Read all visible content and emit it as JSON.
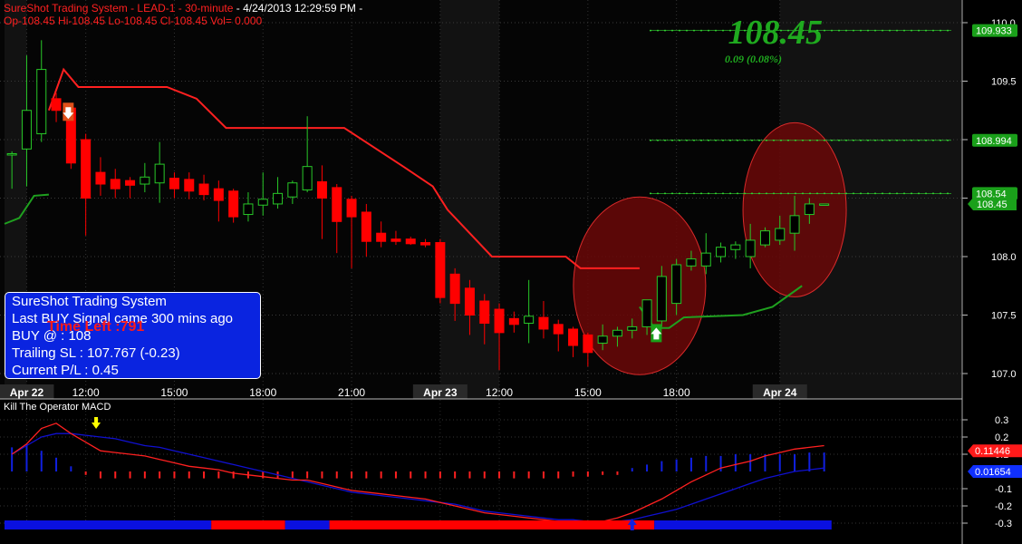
{
  "header": {
    "title": "SureShot Trading System - LEAD-1 - 30-minute",
    "datetime": "- 4/24/2013 12:29:59 PM -",
    "ohlc": "Op-108.45  Hi-108.45  Lo-108.45  Cl-108.45  Vol=   0.000"
  },
  "price_display": {
    "last": "108.45",
    "change": "0.09  (0.08%)"
  },
  "info_box": {
    "title": "SureShot Trading System",
    "signal": "Last BUY Signal came 300 mins ago",
    "entry": "BUY @   : 108",
    "trailing": "Trailing SL : 107.767 (-0.23)",
    "pl": "Current P/L : 0.45",
    "time_left": "Time Left :791"
  },
  "macd_title": "Kill The Operator MACD",
  "colors": {
    "up": "#28c828",
    "down": "#ff0000",
    "stop_up": "#1fa01f",
    "stop_down": "#ff2020",
    "macd_signal": "#1010d0",
    "macd_line": "#ff2020",
    "target": "#30d030",
    "ellipse": "#6a0808"
  },
  "chart_data": [
    {
      "type": "candlestick",
      "yticks": [
        "110.0",
        "109.5",
        "109",
        "108.5",
        "108.0",
        "107.5",
        "107.0"
      ],
      "ylim": [
        106.9,
        110.05
      ],
      "xticks": [
        "Apr 22",
        "12:00",
        "15:00",
        "18:00",
        "21:00",
        "Apr 23",
        "12:00",
        "15:00",
        "18:00",
        "Apr 24"
      ],
      "x_bold": [
        true,
        false,
        false,
        false,
        false,
        true,
        false,
        false,
        false,
        true
      ],
      "x_index": [
        1.5,
        5.5,
        11.5,
        17.5,
        23.5,
        29.5,
        33.5,
        39.5,
        45.5,
        52.5
      ],
      "candles": [
        [
          108.88,
          108.9,
          108.58,
          108.88
        ],
        [
          108.92,
          109.72,
          108.6,
          109.25
        ],
        [
          109.05,
          109.85,
          108.98,
          109.6
        ],
        [
          109.35,
          109.4,
          109.15,
          109.25
        ],
        [
          109.27,
          109.3,
          108.75,
          108.8
        ],
        [
          109.0,
          109.05,
          108.18,
          108.5
        ],
        [
          108.72,
          108.85,
          108.52,
          108.62
        ],
        [
          108.66,
          108.75,
          108.5,
          108.58
        ],
        [
          108.65,
          108.68,
          108.5,
          108.61
        ],
        [
          108.62,
          108.8,
          108.55,
          108.68
        ],
        [
          108.63,
          108.98,
          108.46,
          108.79
        ],
        [
          108.67,
          108.72,
          108.5,
          108.58
        ],
        [
          108.66,
          108.72,
          108.49,
          108.56
        ],
        [
          108.62,
          108.7,
          108.48,
          108.53
        ],
        [
          108.58,
          108.65,
          108.3,
          108.48
        ],
        [
          108.56,
          108.58,
          108.29,
          108.34
        ],
        [
          108.36,
          108.55,
          108.3,
          108.45
        ],
        [
          108.44,
          108.72,
          108.35,
          108.49
        ],
        [
          108.45,
          108.68,
          108.41,
          108.54
        ],
        [
          108.51,
          108.65,
          108.45,
          108.63
        ],
        [
          108.57,
          109.2,
          108.55,
          108.77
        ],
        [
          108.64,
          108.78,
          108.15,
          108.5
        ],
        [
          108.59,
          108.62,
          108.03,
          108.3
        ],
        [
          108.49,
          108.52,
          107.9,
          108.34
        ],
        [
          108.38,
          108.45,
          108.0,
          108.13
        ],
        [
          108.2,
          108.3,
          108.08,
          108.13
        ],
        [
          108.15,
          108.22,
          108.1,
          108.13
        ],
        [
          108.15,
          108.17,
          108.1,
          108.11
        ],
        [
          108.12,
          108.15,
          108.08,
          108.1
        ],
        [
          108.12,
          108.15,
          107.6,
          107.65
        ],
        [
          107.85,
          107.9,
          107.45,
          107.6
        ],
        [
          107.73,
          107.8,
          107.33,
          107.5
        ],
        [
          107.62,
          107.68,
          107.25,
          107.43
        ],
        [
          107.55,
          107.6,
          107.03,
          107.35
        ],
        [
          107.47,
          107.53,
          107.35,
          107.42
        ],
        [
          107.43,
          107.8,
          107.26,
          107.49
        ],
        [
          107.48,
          107.62,
          107.3,
          107.38
        ],
        [
          107.42,
          107.46,
          107.19,
          107.34
        ],
        [
          107.38,
          107.4,
          107.14,
          107.24
        ],
        [
          107.33,
          107.35,
          107.06,
          107.18
        ],
        [
          107.26,
          107.42,
          107.2,
          107.32
        ],
        [
          107.32,
          107.4,
          107.23,
          107.37
        ],
        [
          107.37,
          107.47,
          107.3,
          107.4
        ],
        [
          107.4,
          107.6,
          107.33,
          107.63
        ],
        [
          107.45,
          107.92,
          107.4,
          107.83
        ],
        [
          107.6,
          107.98,
          107.5,
          107.93
        ],
        [
          107.92,
          108.05,
          107.88,
          107.98
        ],
        [
          107.92,
          108.2,
          107.85,
          108.03
        ],
        [
          108.0,
          108.12,
          107.95,
          108.08
        ],
        [
          108.06,
          108.13,
          107.98,
          108.1
        ],
        [
          108.0,
          108.28,
          107.9,
          108.14
        ],
        [
          108.1,
          108.25,
          108.08,
          108.22
        ],
        [
          108.14,
          108.35,
          108.1,
          108.24
        ],
        [
          108.2,
          108.52,
          108.05,
          108.35
        ],
        [
          108.36,
          108.5,
          108.28,
          108.45
        ],
        [
          108.45,
          108.45,
          108.45,
          108.45
        ]
      ],
      "stop_line_up_1": [
        [
          0,
          108.28
        ],
        [
          1,
          108.33
        ],
        [
          2,
          108.52
        ],
        [
          3,
          108.53
        ]
      ],
      "stop_line_down": [
        [
          3,
          109.25
        ],
        [
          4,
          109.6
        ],
        [
          5,
          109.45
        ],
        [
          11,
          109.45
        ],
        [
          13,
          109.35
        ],
        [
          15,
          109.1
        ],
        [
          23,
          109.1
        ],
        [
          27,
          108.77
        ],
        [
          29,
          108.6
        ],
        [
          30,
          108.4
        ],
        [
          33,
          108.0
        ],
        [
          38,
          108.0
        ],
        [
          39,
          107.9
        ],
        [
          43,
          107.9
        ]
      ],
      "stop_line_up_2": [
        [
          43,
          107.57
        ],
        [
          44,
          107.39
        ],
        [
          45,
          107.39
        ],
        [
          46,
          107.48
        ],
        [
          50,
          107.5
        ],
        [
          52,
          107.57
        ],
        [
          54,
          107.75
        ]
      ],
      "target_levels": [
        {
          "value": 109.933,
          "label": "109.933"
        },
        {
          "value": 108.994,
          "label": "108.994"
        },
        {
          "value": 108.54,
          "label": "108.54"
        }
      ],
      "price_tag": "108.45",
      "sell_signal_index": 4,
      "buy_signal_index": 44
    },
    {
      "type": "macd",
      "yticks": [
        "0.3",
        "0.2",
        "0.1",
        "-0.1",
        "-0.2",
        "-0.3"
      ],
      "ylim": [
        -0.31,
        0.31
      ],
      "macd_line": [
        0.1,
        0.16,
        0.25,
        0.28,
        0.22,
        0.17,
        0.12,
        0.11,
        0.1,
        0.09,
        0.07,
        0.05,
        0.03,
        0.02,
        0.01,
        -0.01,
        -0.02,
        -0.03,
        -0.04,
        -0.05,
        -0.05,
        -0.07,
        -0.09,
        -0.11,
        -0.12,
        -0.13,
        -0.14,
        -0.15,
        -0.16,
        -0.18,
        -0.2,
        -0.22,
        -0.24,
        -0.25,
        -0.26,
        -0.27,
        -0.28,
        -0.29,
        -0.3,
        -0.31,
        -0.29,
        -0.27,
        -0.24,
        -0.2,
        -0.16,
        -0.11,
        -0.06,
        -0.02,
        0.02,
        0.04,
        0.06,
        0.09,
        0.11,
        0.13,
        0.14,
        0.15
      ],
      "signal_line": [
        0.1,
        0.15,
        0.2,
        0.22,
        0.22,
        0.21,
        0.2,
        0.19,
        0.17,
        0.15,
        0.14,
        0.12,
        0.1,
        0.08,
        0.06,
        0.04,
        0.02,
        0.0,
        -0.02,
        -0.04,
        -0.06,
        -0.08,
        -0.1,
        -0.12,
        -0.13,
        -0.14,
        -0.15,
        -0.16,
        -0.17,
        -0.18,
        -0.19,
        -0.21,
        -0.23,
        -0.24,
        -0.25,
        -0.26,
        -0.27,
        -0.28,
        -0.28,
        -0.29,
        -0.29,
        -0.29,
        -0.28,
        -0.26,
        -0.24,
        -0.22,
        -0.19,
        -0.16,
        -0.13,
        -0.1,
        -0.07,
        -0.04,
        -0.02,
        0.0,
        0.01,
        0.02
      ],
      "histogram": [
        0.14,
        0.16,
        0.12,
        0.08,
        0.03,
        -0.02,
        -0.04,
        -0.04,
        -0.04,
        -0.04,
        -0.04,
        -0.04,
        -0.04,
        -0.04,
        -0.04,
        -0.04,
        -0.04,
        -0.04,
        -0.04,
        -0.04,
        -0.04,
        -0.04,
        -0.04,
        -0.04,
        -0.04,
        -0.04,
        -0.04,
        -0.04,
        -0.04,
        -0.04,
        -0.04,
        -0.04,
        -0.04,
        -0.04,
        -0.04,
        -0.04,
        -0.04,
        -0.04,
        -0.03,
        -0.03,
        -0.02,
        -0.02,
        0.02,
        0.04,
        0.06,
        0.07,
        0.08,
        0.09,
        0.09,
        0.1,
        0.1,
        0.1,
        0.1,
        0.1,
        0.11,
        0.11
      ],
      "labels": {
        "macd": "0.11446",
        "signal": "0.01654"
      },
      "trend_bar": [
        {
          "from": 0,
          "to": 14,
          "color": "#0a10e0"
        },
        {
          "from": 14,
          "to": 19,
          "color": "#ff0000"
        },
        {
          "from": 19,
          "to": 22,
          "color": "#0a10e0"
        },
        {
          "from": 22,
          "to": 44,
          "color": "#ff0000"
        },
        {
          "from": 44,
          "to": 56,
          "color": "#0a10e0"
        }
      ]
    }
  ]
}
